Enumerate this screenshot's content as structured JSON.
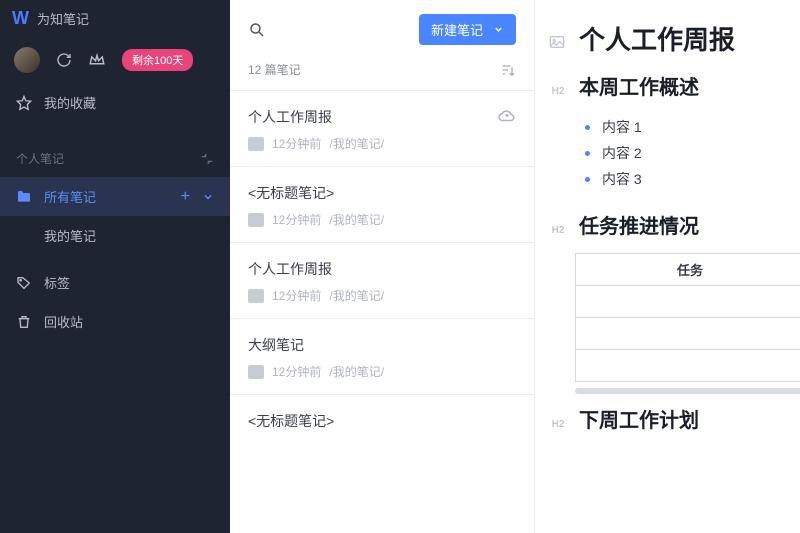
{
  "app": {
    "name": "为知笔记"
  },
  "profile": {
    "badge": "剩余100天"
  },
  "sidebar": {
    "favorites": "我的收藏",
    "section": "个人笔记",
    "allNotes": "所有笔记",
    "myNotes": "我的笔记",
    "tags": "标签",
    "trash": "回收站"
  },
  "list": {
    "newButton": "新建笔记",
    "count": "12 篇笔记",
    "items": [
      {
        "title": "个人工作周报",
        "time": "12分钟前",
        "path": "/我的笔记/",
        "cloud": true
      },
      {
        "title": "<无标题笔记>",
        "time": "12分钟前",
        "path": "/我的笔记/",
        "cloud": false
      },
      {
        "title": "个人工作周报",
        "time": "12分钟前",
        "path": "/我的笔记/",
        "cloud": false
      },
      {
        "title": "大纲笔记",
        "time": "12分钟前",
        "path": "/我的笔记/",
        "cloud": false
      },
      {
        "title": "<无标题笔记>",
        "time": "",
        "path": "",
        "cloud": false
      }
    ]
  },
  "editor": {
    "title": "个人工作周报",
    "h2a": "本周工作概述",
    "bullets": [
      "内容 1",
      "内容 2",
      "内容 3"
    ],
    "h2b": "任务推进情况",
    "tableHeader": "任务",
    "h2c": "下周工作计划"
  }
}
